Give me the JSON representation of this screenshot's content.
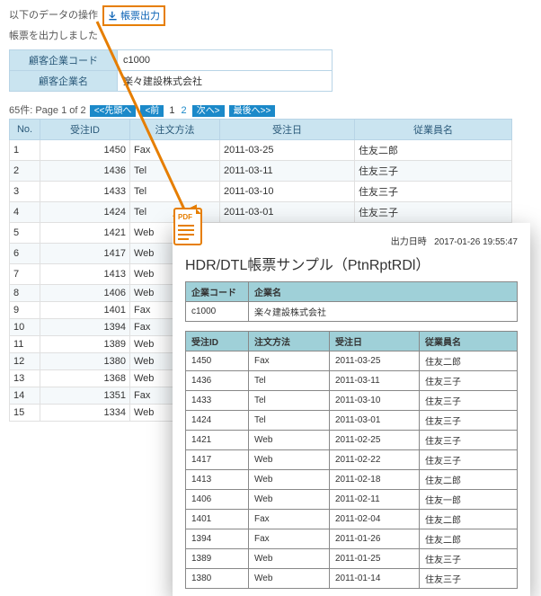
{
  "web": {
    "top_prefix": "以下のデータの操作",
    "output_label": "帳票出力",
    "status": "帳票を出力しました",
    "filter": {
      "code_label": "顧客企業コード",
      "code_value": "c1000",
      "name_label": "顧客企業名",
      "name_value": "楽々建設株式会社"
    },
    "pager": {
      "count_text": "65件: Page 1 of 2",
      "first": "<<先頭へ",
      "prev": "<前",
      "p1": "1",
      "p2": "2",
      "next": "次へ>",
      "last": "最後へ>>"
    },
    "cols": {
      "no": "No.",
      "id": "受注ID",
      "method": "注文方法",
      "date": "受注日",
      "emp": "従業員名"
    },
    "rows": [
      {
        "no": "1",
        "id": "1450",
        "method": "Fax",
        "date": "2011-03-25",
        "emp": "住友二郎"
      },
      {
        "no": "2",
        "id": "1436",
        "method": "Tel",
        "date": "2011-03-11",
        "emp": "住友三子"
      },
      {
        "no": "3",
        "id": "1433",
        "method": "Tel",
        "date": "2011-03-10",
        "emp": "住友三子"
      },
      {
        "no": "4",
        "id": "1424",
        "method": "Tel",
        "date": "2011-03-01",
        "emp": "住友三子"
      },
      {
        "no": "5",
        "id": "1421",
        "method": "Web",
        "date": "2011-02-25",
        "emp": "住友三子"
      },
      {
        "no": "6",
        "id": "1417",
        "method": "Web",
        "date": "2011-02-22",
        "emp": "住友三子"
      },
      {
        "no": "7",
        "id": "1413",
        "method": "Web",
        "date": "2011-02-18",
        "emp": "住友二郎"
      },
      {
        "no": "8",
        "id": "1406",
        "method": "Web",
        "date": "",
        "emp": ""
      },
      {
        "no": "9",
        "id": "1401",
        "method": "Fax",
        "date": "",
        "emp": ""
      },
      {
        "no": "10",
        "id": "1394",
        "method": "Fax",
        "date": "",
        "emp": ""
      },
      {
        "no": "11",
        "id": "1389",
        "method": "Web",
        "date": "",
        "emp": ""
      },
      {
        "no": "12",
        "id": "1380",
        "method": "Web",
        "date": "",
        "emp": ""
      },
      {
        "no": "13",
        "id": "1368",
        "method": "Web",
        "date": "",
        "emp": ""
      },
      {
        "no": "14",
        "id": "1351",
        "method": "Fax",
        "date": "",
        "emp": ""
      },
      {
        "no": "15",
        "id": "1334",
        "method": "Web",
        "date": "",
        "emp": ""
      }
    ]
  },
  "pdf": {
    "dt_label": "出力日時",
    "dt_value": "2017-01-26 19:55:47",
    "title": "HDR/DTL帳票サンプル（PtnRptRDl）",
    "company_code_label": "企業コード",
    "company_name_label": "企業名",
    "company_code": "c1000",
    "company_name": "楽々建設株式会社",
    "cols": {
      "id": "受注ID",
      "method": "注文方法",
      "date": "受注日",
      "emp": "従業員名"
    },
    "rows": [
      {
        "id": "1450",
        "method": "Fax",
        "date": "2011-03-25",
        "emp": "住友二郎"
      },
      {
        "id": "1436",
        "method": "Tel",
        "date": "2011-03-11",
        "emp": "住友三子"
      },
      {
        "id": "1433",
        "method": "Tel",
        "date": "2011-03-10",
        "emp": "住友三子"
      },
      {
        "id": "1424",
        "method": "Tel",
        "date": "2011-03-01",
        "emp": "住友三子"
      },
      {
        "id": "1421",
        "method": "Web",
        "date": "2011-02-25",
        "emp": "住友三子"
      },
      {
        "id": "1417",
        "method": "Web",
        "date": "2011-02-22",
        "emp": "住友三子"
      },
      {
        "id": "1413",
        "method": "Web",
        "date": "2011-02-18",
        "emp": "住友二郎"
      },
      {
        "id": "1406",
        "method": "Web",
        "date": "2011-02-11",
        "emp": "住友一郎"
      },
      {
        "id": "1401",
        "method": "Fax",
        "date": "2011-02-04",
        "emp": "住友二郎"
      },
      {
        "id": "1394",
        "method": "Fax",
        "date": "2011-01-26",
        "emp": "住友二郎"
      },
      {
        "id": "1389",
        "method": "Web",
        "date": "2011-01-25",
        "emp": "住友三子"
      },
      {
        "id": "1380",
        "method": "Web",
        "date": "2011-01-14",
        "emp": "住友三子"
      }
    ]
  }
}
